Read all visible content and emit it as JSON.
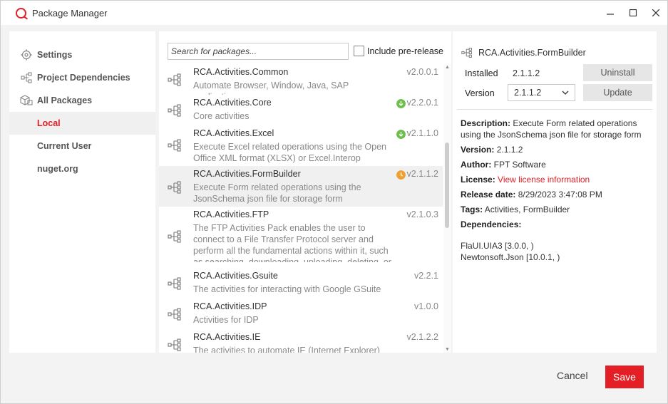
{
  "window": {
    "title": "Package Manager"
  },
  "sidebar": {
    "items": [
      {
        "label": "Settings",
        "icon": "gear-icon"
      },
      {
        "label": "Project Dependencies",
        "icon": "tree-icon"
      },
      {
        "label": "All Packages",
        "icon": "boxes-icon"
      },
      {
        "label": "Local"
      },
      {
        "label": "Current User"
      },
      {
        "label": "nuget.org"
      }
    ],
    "active": "Local"
  },
  "search": {
    "placeholder": "Search for packages...",
    "include_prerelease_label": "Include pre-release"
  },
  "packages": [
    {
      "name": "RCA.Activities.Common",
      "description": "Automate Browser, Window, Java, SAP applications",
      "version": "v2.0.0.1",
      "status": ""
    },
    {
      "name": "RCA.Activities.Core",
      "description": "Core activities",
      "version": "v2.2.0.1",
      "status": "update-available"
    },
    {
      "name": "RCA.Activities.Excel",
      "description": "Execute Excel related operations using the Open Office XML format (XLSX) or Excel.Interop",
      "version": "v2.1.1.0",
      "status": "update-available"
    },
    {
      "name": "RCA.Activities.FormBuilder",
      "description": "Execute Form related operations using the JsonSchema json file for storage form",
      "version": "v2.1.1.2",
      "status": "pending"
    },
    {
      "name": "RCA.Activities.FTP",
      "description": "The FTP Activities Pack enables the user to connect to a File Transfer Protocol server and perform all the fundamental actions within it, such as searching, downloading, uploading, deleting, or",
      "version": "v2.1.0.3",
      "status": ""
    },
    {
      "name": "RCA.Activities.Gsuite",
      "description": "The activities for interacting with Google GSuite",
      "version": "v2.2.1",
      "status": ""
    },
    {
      "name": "RCA.Activities.IDP",
      "description": "Activities for IDP",
      "version": "v1.0.0",
      "status": ""
    },
    {
      "name": "RCA.Activities.IE",
      "description": "The activities to automate IE (Internet Explorer)",
      "version": "v2.1.2.2",
      "status": ""
    }
  ],
  "details": {
    "name": "RCA.Activities.FormBuilder",
    "installed_label": "Installed",
    "installed_value": "2.1.1.2",
    "version_label": "Version",
    "version_value": "2.1.1.2",
    "uninstall_label": "Uninstall",
    "update_label": "Update",
    "description_label": "Description:",
    "description": "Execute Form related operations using the JsonSchema json file for storage form",
    "version_row_label": "Version:",
    "version_row_value": "2.1.1.2",
    "author_label": "Author:",
    "author": "FPT Software",
    "license_label": "License:",
    "license_link": "View license information",
    "release_label": "Release date:",
    "release_date": "8/29/2023 3:47:08 PM",
    "tags_label": "Tags:",
    "tags": "Activities, FormBuilder",
    "dependencies_label": "Dependencies:",
    "dependencies": [
      "FlaUI.UIA3 [3.0.0, )",
      "Newtonsoft.Json [10.0.1, )"
    ]
  },
  "footer": {
    "cancel_label": "Cancel",
    "save_label": "Save"
  },
  "colors": {
    "accent": "#e31e24",
    "update": "#6cbf4a",
    "pending": "#f0a030"
  }
}
